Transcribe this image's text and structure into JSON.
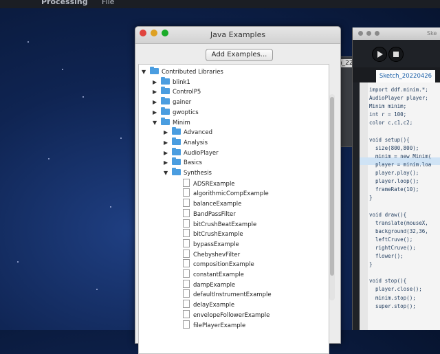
{
  "menubar": {
    "app": "Processing",
    "file": "File"
  },
  "examples_window": {
    "title": "Java Examples",
    "add_button": "Add Examples...",
    "tree": [
      {
        "label": "Contributed Libraries",
        "level": 0,
        "type": "folder",
        "expanded": true
      },
      {
        "label": "blink1",
        "level": 1,
        "type": "folder",
        "expanded": false
      },
      {
        "label": "ControlP5",
        "level": 1,
        "type": "folder",
        "expanded": false
      },
      {
        "label": "gainer",
        "level": 1,
        "type": "folder",
        "expanded": false
      },
      {
        "label": "gwoptics",
        "level": 1,
        "type": "folder",
        "expanded": false
      },
      {
        "label": "Minim",
        "level": 1,
        "type": "folder",
        "expanded": true
      },
      {
        "label": "Advanced",
        "level": 2,
        "type": "folder",
        "expanded": false
      },
      {
        "label": "Analysis",
        "level": 2,
        "type": "folder",
        "expanded": false
      },
      {
        "label": "AudioPlayer",
        "level": 2,
        "type": "folder",
        "expanded": false
      },
      {
        "label": "Basics",
        "level": 2,
        "type": "folder",
        "expanded": false
      },
      {
        "label": "Synthesis",
        "level": 2,
        "type": "folder",
        "expanded": true
      },
      {
        "label": "ADSRExample",
        "level": 3,
        "type": "file"
      },
      {
        "label": "algorithmicCompExample",
        "level": 3,
        "type": "file"
      },
      {
        "label": "balanceExample",
        "level": 3,
        "type": "file"
      },
      {
        "label": "BandPassFilter",
        "level": 3,
        "type": "file"
      },
      {
        "label": "bitCrushBeatExample",
        "level": 3,
        "type": "file"
      },
      {
        "label": "bitCrushExample",
        "level": 3,
        "type": "file"
      },
      {
        "label": "bypassExample",
        "level": 3,
        "type": "file"
      },
      {
        "label": "ChebyshevFilter",
        "level": 3,
        "type": "file"
      },
      {
        "label": "compositionExample",
        "level": 3,
        "type": "file"
      },
      {
        "label": "constantExample",
        "level": 3,
        "type": "file"
      },
      {
        "label": "dampExample",
        "level": 3,
        "type": "file"
      },
      {
        "label": "defaultInstrumentExample",
        "level": 3,
        "type": "file"
      },
      {
        "label": "delayExample",
        "level": 3,
        "type": "file"
      },
      {
        "label": "envelopeFollowerExample",
        "level": 3,
        "type": "file"
      },
      {
        "label": "filePlayerExample",
        "level": 3,
        "type": "file"
      }
    ]
  },
  "background_window": {
    "tab_label": "ch_22"
  },
  "sketch_window": {
    "title": "Ske",
    "tab_label": "Sketch_20220426",
    "code_lines": [
      "import ddf.minim.*;",
      "AudioPlayer player;",
      "Minim minim;",
      "int r = 100;",
      "color c,c1,c2;",
      "",
      "void setup(){",
      "  size(800,800);",
      "  minim = new Minim(",
      "  player = minim.loa",
      "  player.play();",
      "  player.loop();",
      "  frameRate(10);",
      "}",
      "",
      "void draw(){",
      "  translate(mouseX,",
      "  background(32,36,",
      "  leftCruve();",
      "  rightCruve();",
      "  flower();",
      "}",
      "",
      "void stop(){",
      "  player.close();",
      "  minim.stop();",
      "  super.stop();"
    ]
  },
  "colors": {
    "folder": "#4a9de0",
    "close": "#e0443e",
    "minimize": "#dea123",
    "zoom": "#1aab29"
  }
}
